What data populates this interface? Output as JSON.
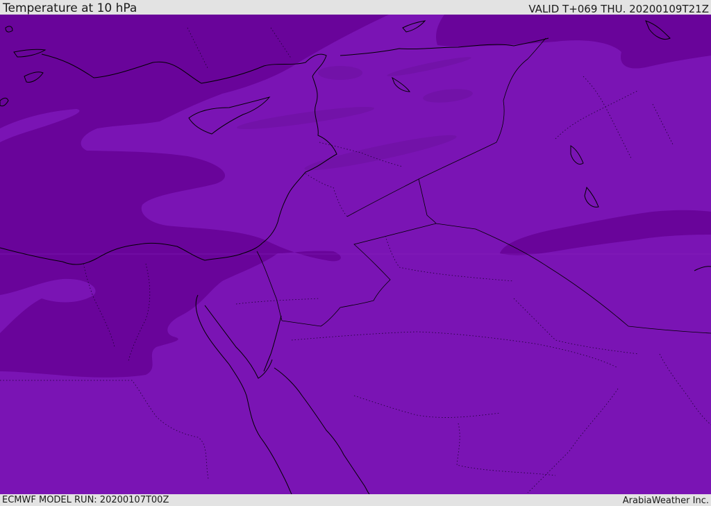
{
  "header": {
    "title": "Temperature at 10 hPa",
    "valid_time": "VALID T+069 THU. 20200109T21Z"
  },
  "footer": {
    "model_run": "ECMWF MODEL RUN: 20200107T00Z",
    "credit": "ArabiaWeather Inc."
  },
  "map": {
    "background_color": "#7a14b4",
    "contour_colors": {
      "cooler": "#69049a",
      "mid": "#7212a8",
      "base": "#7a14b4"
    },
    "coastline_color": "#000000",
    "border_style": "dotted"
  }
}
